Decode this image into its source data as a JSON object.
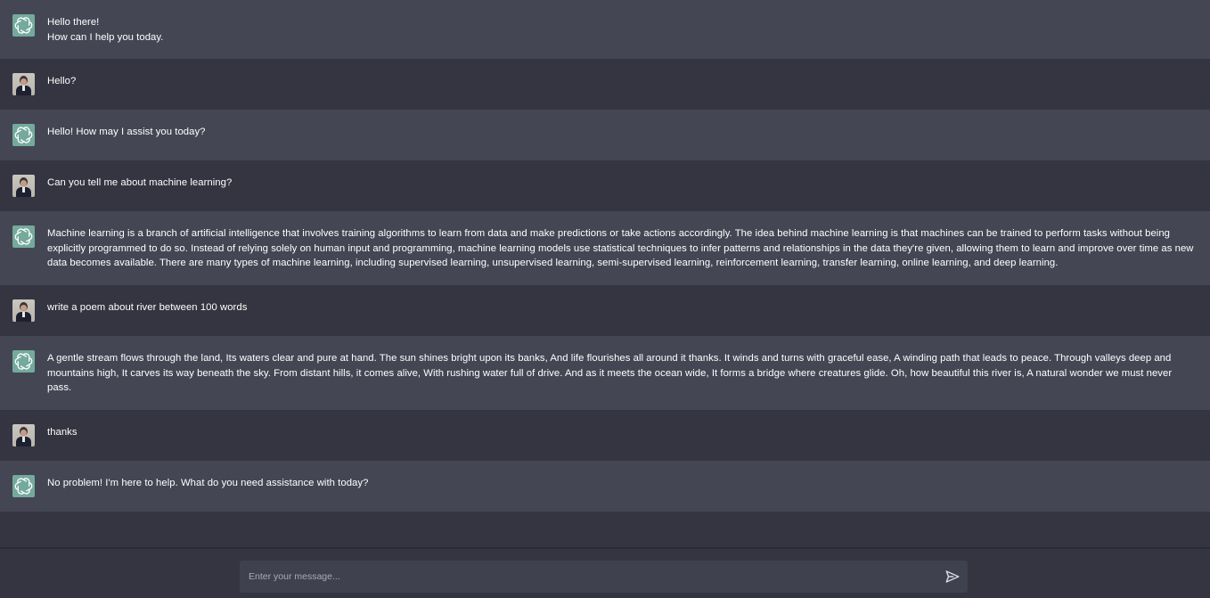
{
  "colors": {
    "bot_row_bg": "#444654",
    "user_row_bg": "#343541",
    "input_bg": "#40414f",
    "bot_avatar_bg": "#74aa9c",
    "text": "#ffffff"
  },
  "messages": [
    {
      "role": "bot",
      "avatar_icon": "openai-logo-icon",
      "text": "Hello there!\nHow can I help you today."
    },
    {
      "role": "user",
      "avatar_icon": "user-photo-avatar",
      "text": "Hello?"
    },
    {
      "role": "bot",
      "avatar_icon": "openai-logo-icon",
      "text": "Hello! How may I assist you today?"
    },
    {
      "role": "user",
      "avatar_icon": "user-photo-avatar",
      "text": "Can you tell me about machine learning?"
    },
    {
      "role": "bot",
      "avatar_icon": "openai-logo-icon",
      "text": "Machine learning is a branch of artificial intelligence that involves training algorithms to learn from data and make predictions or take actions accordingly. The idea behind machine learning is that machines can be trained to perform tasks without being explicitly programmed to do so. Instead of relying solely on human input and programming, machine learning models use statistical techniques to infer patterns and relationships in the data they're given, allowing them to learn and improve over time as new data becomes available. There are many types of machine learning, including supervised learning, unsupervised learning, semi-supervised learning, reinforcement learning, transfer learning, online learning, and deep learning."
    },
    {
      "role": "user",
      "avatar_icon": "user-photo-avatar",
      "text": "write a poem about river between 100 words"
    },
    {
      "role": "bot",
      "avatar_icon": "openai-logo-icon",
      "text": "A gentle stream flows through the land, Its waters clear and pure at hand. The sun shines bright upon its banks, And life flourishes all around it thanks. It winds and turns with graceful ease, A winding path that leads to peace. Through valleys deep and mountains high, It carves its way beneath the sky. From distant hills, it comes alive, With rushing water full of drive. And as it meets the ocean wide, It forms a bridge where creatures glide. Oh, how beautiful this river is, A natural wonder we must never pass."
    },
    {
      "role": "user",
      "avatar_icon": "user-photo-avatar",
      "text": "thanks"
    },
    {
      "role": "bot",
      "avatar_icon": "openai-logo-icon",
      "text": "No problem! I'm here to help. What do you need assistance with today?"
    }
  ],
  "composer": {
    "placeholder": "Enter your message...",
    "value": "",
    "send_icon": "send-icon"
  }
}
